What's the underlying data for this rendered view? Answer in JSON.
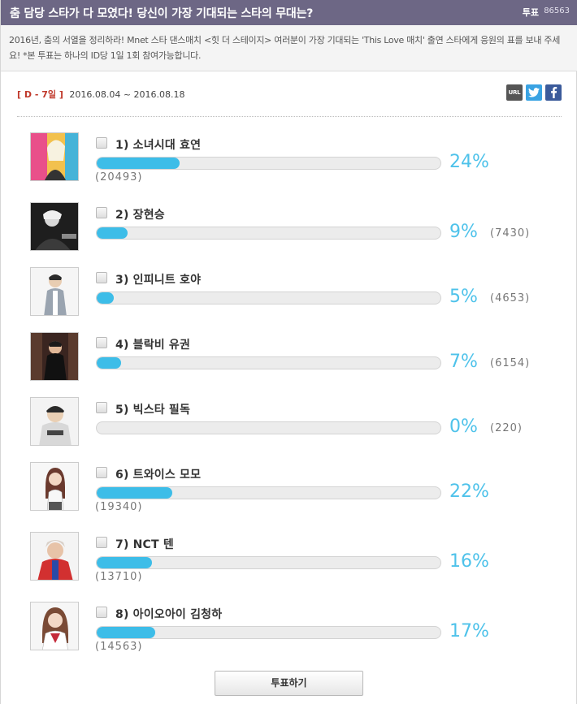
{
  "header": {
    "title": "춤 담당 스타가 다 모였다! 당신이 가장 기대되는 스타의 무대는?",
    "poll_label": "투표",
    "poll_count": "86563"
  },
  "description": "2016년, 춤의 서열을 정리하라! Mnet 스타 댄스매치 <힛 더 스테이지> 여러분이 가장 기대되는 'This Love 매치' 출연 스타에게 응원의 표를 보내 주세요! *본 투표는 하나의 ID당 1일 1회 참여가능합니다.",
  "period": {
    "dday": "[ D - 7일 ]",
    "range": "2016.08.04 ~ 2016.08.18"
  },
  "share": {
    "url_icon": "URL",
    "twitter_icon": "twitter-icon",
    "facebook_icon": "facebook-icon"
  },
  "colors": {
    "header_bg": "#6d6785",
    "bar_fill": "#3dbde8",
    "percent_text": "#4ec2ea"
  },
  "candidates": [
    {
      "label": "1) 소녀시대 효연",
      "percent": "24%",
      "percent_value": 24,
      "count": "(20493)"
    },
    {
      "label": "2) 장현승",
      "percent": "9%",
      "percent_value": 9,
      "count": "(7430)"
    },
    {
      "label": "3) 인피니트 호야",
      "percent": "5%",
      "percent_value": 5,
      "count": "(4653)"
    },
    {
      "label": "4) 블락비 유권",
      "percent": "7%",
      "percent_value": 7,
      "count": "(6154)"
    },
    {
      "label": "5) 빅스타 필독",
      "percent": "0%",
      "percent_value": 0,
      "count": "(220)"
    },
    {
      "label": "6) 트와이스 모모",
      "percent": "22%",
      "percent_value": 22,
      "count": "(19340)"
    },
    {
      "label": "7) NCT 텐",
      "percent": "16%",
      "percent_value": 16,
      "count": "(13710)"
    },
    {
      "label": "8) 아이오아이 김청하",
      "percent": "17%",
      "percent_value": 17,
      "count": "(14563)"
    }
  ],
  "vote_button": "투표하기"
}
